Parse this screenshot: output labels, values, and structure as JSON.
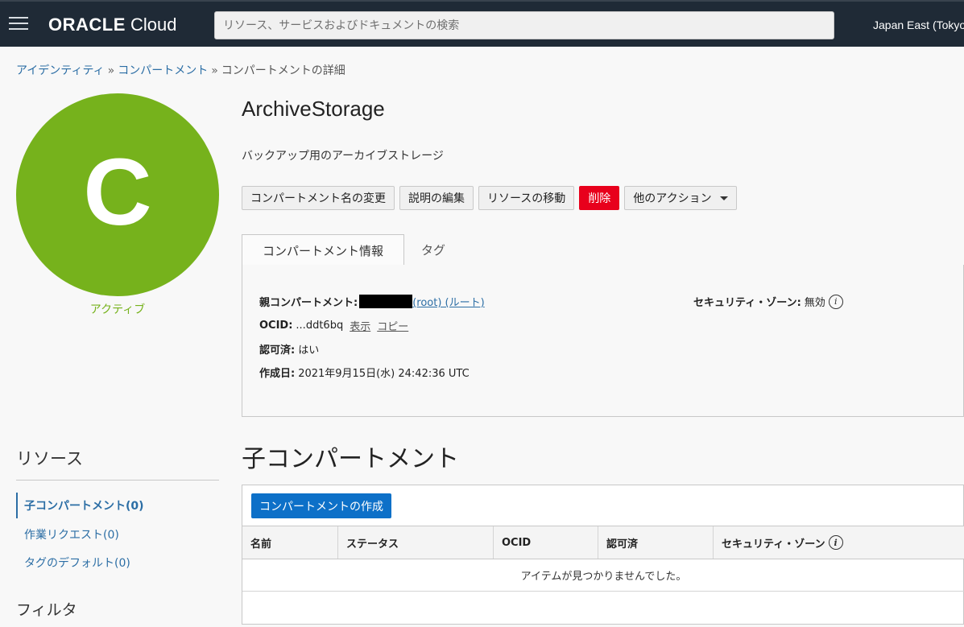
{
  "topbar": {
    "brand": "ORACLE",
    "product": "Cloud",
    "search_placeholder": "リソース、サービスおよびドキュメントの検索",
    "region": "Japan East (Tokyo)"
  },
  "breadcrumb": {
    "items": [
      "アイデンティティ",
      "コンパートメント",
      "コンパートメントの詳細"
    ],
    "separator": "»"
  },
  "avatar": {
    "letter": "C",
    "status": "アクティブ",
    "color": "#76b21c"
  },
  "header": {
    "title": "ArchiveStorage",
    "description": "バックアップ用のアーカイブストレージ"
  },
  "actions": {
    "rename": "コンパートメント名の変更",
    "edit_description": "説明の編集",
    "move_resource": "リソースの移動",
    "delete": "削除",
    "more_actions": "他のアクション"
  },
  "tabs": {
    "info": "コンパートメント情報",
    "tags": "タグ"
  },
  "info": {
    "parent_label": "親コンパートメント:",
    "parent_link": "(root) (ルート)",
    "ocid_label": "OCID:",
    "ocid_value": "...ddt6bq",
    "show": "表示",
    "copy": "コピー",
    "authorized_label": "認可済:",
    "authorized_value": "はい",
    "created_label": "作成日:",
    "created_value": "2021年9月15日(水) 24:42:36 UTC",
    "security_zone_label": "セキュリティ・ゾーン:",
    "security_zone_value": "無効"
  },
  "resources": {
    "title": "リソース",
    "items": [
      "子コンパートメント(0)",
      "作業リクエスト(0)",
      "タグのデフォルト(0)"
    ],
    "filter_title": "フィルタ"
  },
  "children": {
    "title": "子コンパートメント",
    "create_button": "コンパートメントの作成",
    "columns": [
      "名前",
      "ステータス",
      "OCID",
      "認可済",
      "セキュリティ・ゾーン"
    ],
    "empty_message": "アイテムが見つかりませんでした。"
  },
  "colors": {
    "accent": "#2c6ea5",
    "danger": "#e8001c",
    "primary": "#0d70c8",
    "topbar": "#1f2a36"
  }
}
